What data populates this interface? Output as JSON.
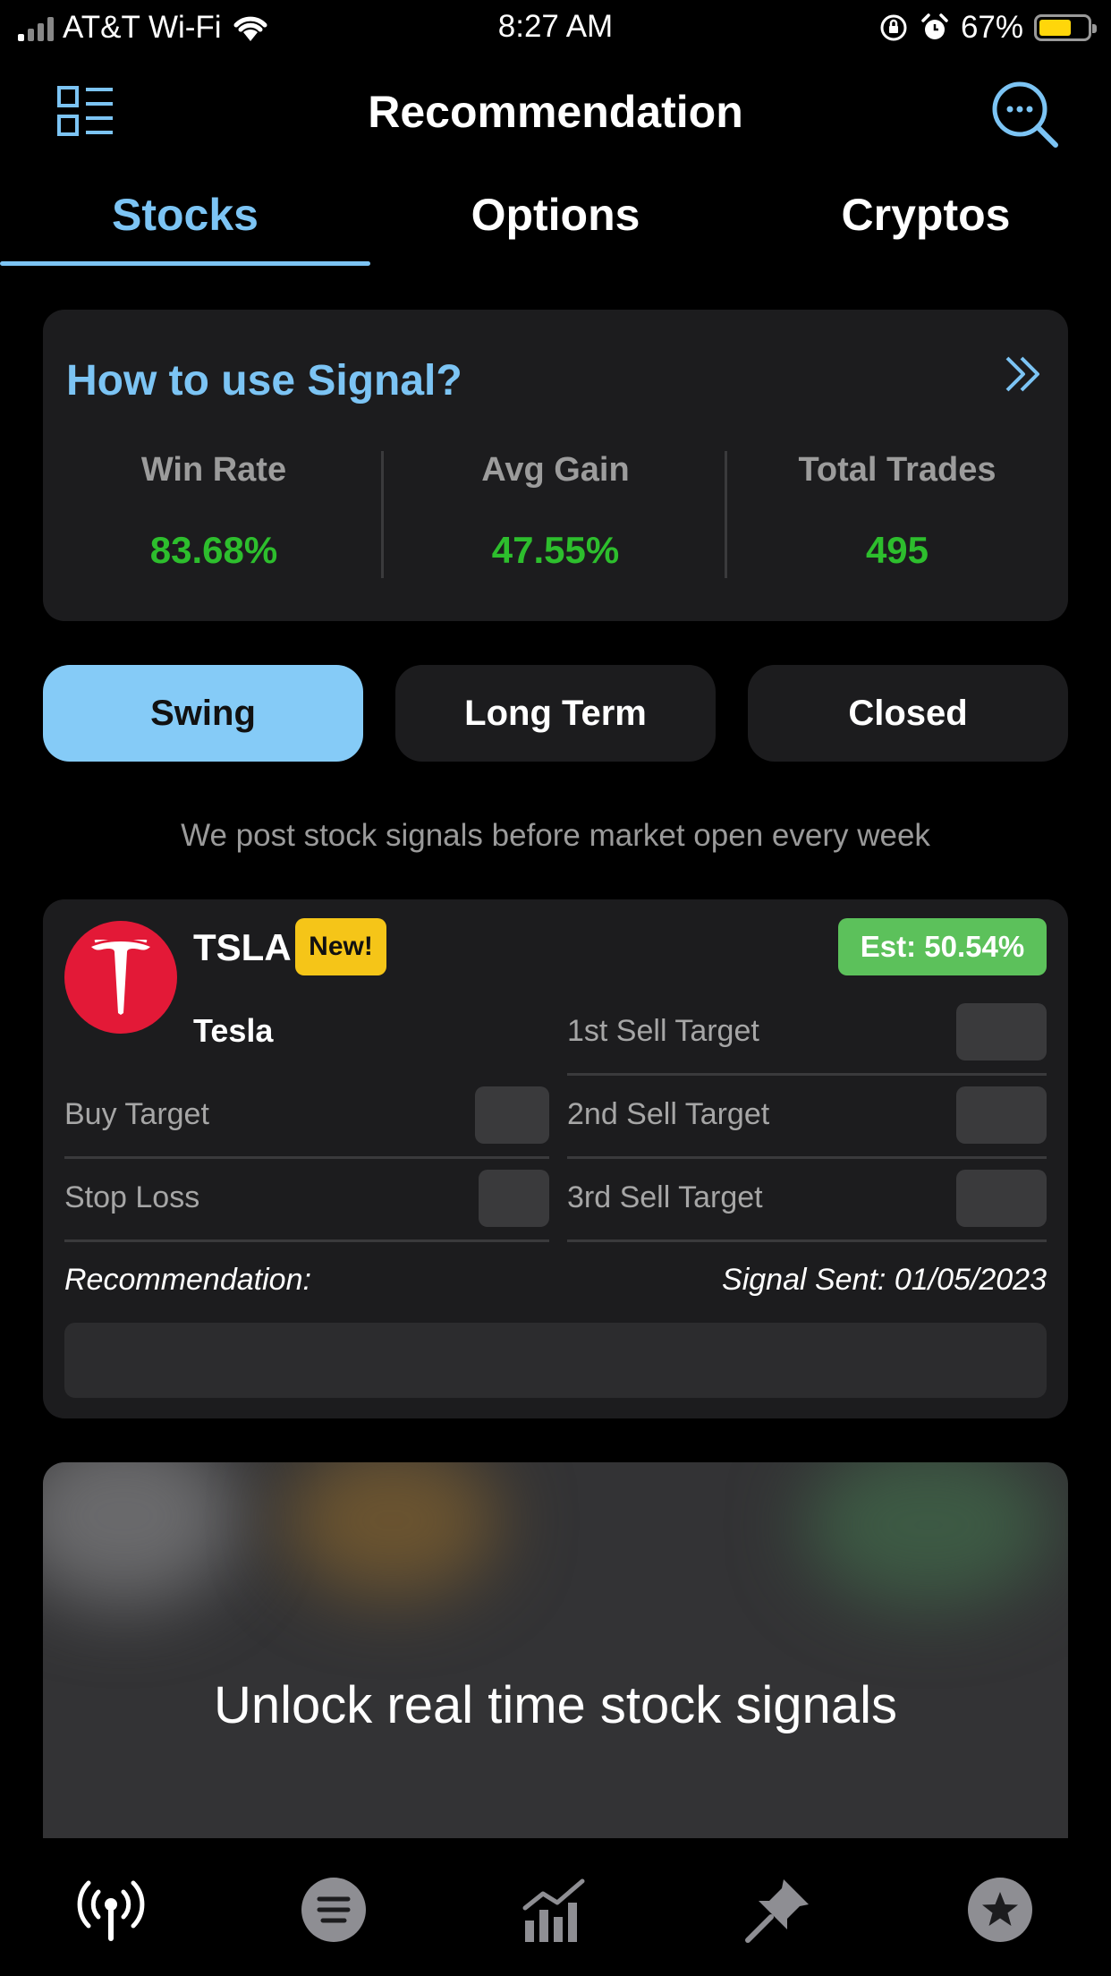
{
  "status_bar": {
    "carrier": "AT&T Wi-Fi",
    "time": "8:27 AM",
    "battery": "67%",
    "battery_level": 0.67,
    "battery_color": "#FFD60A"
  },
  "header": {
    "title": "Recommendation",
    "left_icon": "list-menu-icon",
    "right_icon": "search-icon"
  },
  "tabs": [
    {
      "label": "Stocks",
      "active": true
    },
    {
      "label": "Options",
      "active": false
    },
    {
      "label": "Cryptos",
      "active": false
    }
  ],
  "signal_card": {
    "title": "How to use Signal?",
    "stats": [
      {
        "label": "Win Rate",
        "value": "83.68%"
      },
      {
        "label": "Avg Gain",
        "value": "47.55%"
      },
      {
        "label": "Total Trades",
        "value": "495"
      }
    ]
  },
  "segments": [
    {
      "label": "Swing",
      "active": true
    },
    {
      "label": "Long Term",
      "active": false
    },
    {
      "label": "Closed",
      "active": false
    }
  ],
  "notice": "We post stock signals before market open every week",
  "stock": {
    "ticker": "TSLA",
    "badge": "New!",
    "est": "Est: 50.54%",
    "company": "Tesla",
    "buy_target_label": "Buy Target",
    "stop_loss_label": "Stop Loss",
    "sell_targets": [
      "1st Sell Target",
      "2nd Sell Target",
      "3rd Sell Target"
    ],
    "recommendation_label": "Recommendation:",
    "signal_sent": "Signal Sent: 01/05/2023"
  },
  "unlock": {
    "text": "Unlock real time stock signals"
  },
  "tabbar": [
    "signal-broadcast-icon",
    "news-list-icon",
    "chart-bars-icon",
    "pin-icon",
    "star-icon"
  ],
  "colors": {
    "accent": "#7CC4F4",
    "positive": "#2DBE2D",
    "badge_new": "#F5C518",
    "badge_est": "#5CC15B",
    "tesla_red": "#E31937"
  }
}
